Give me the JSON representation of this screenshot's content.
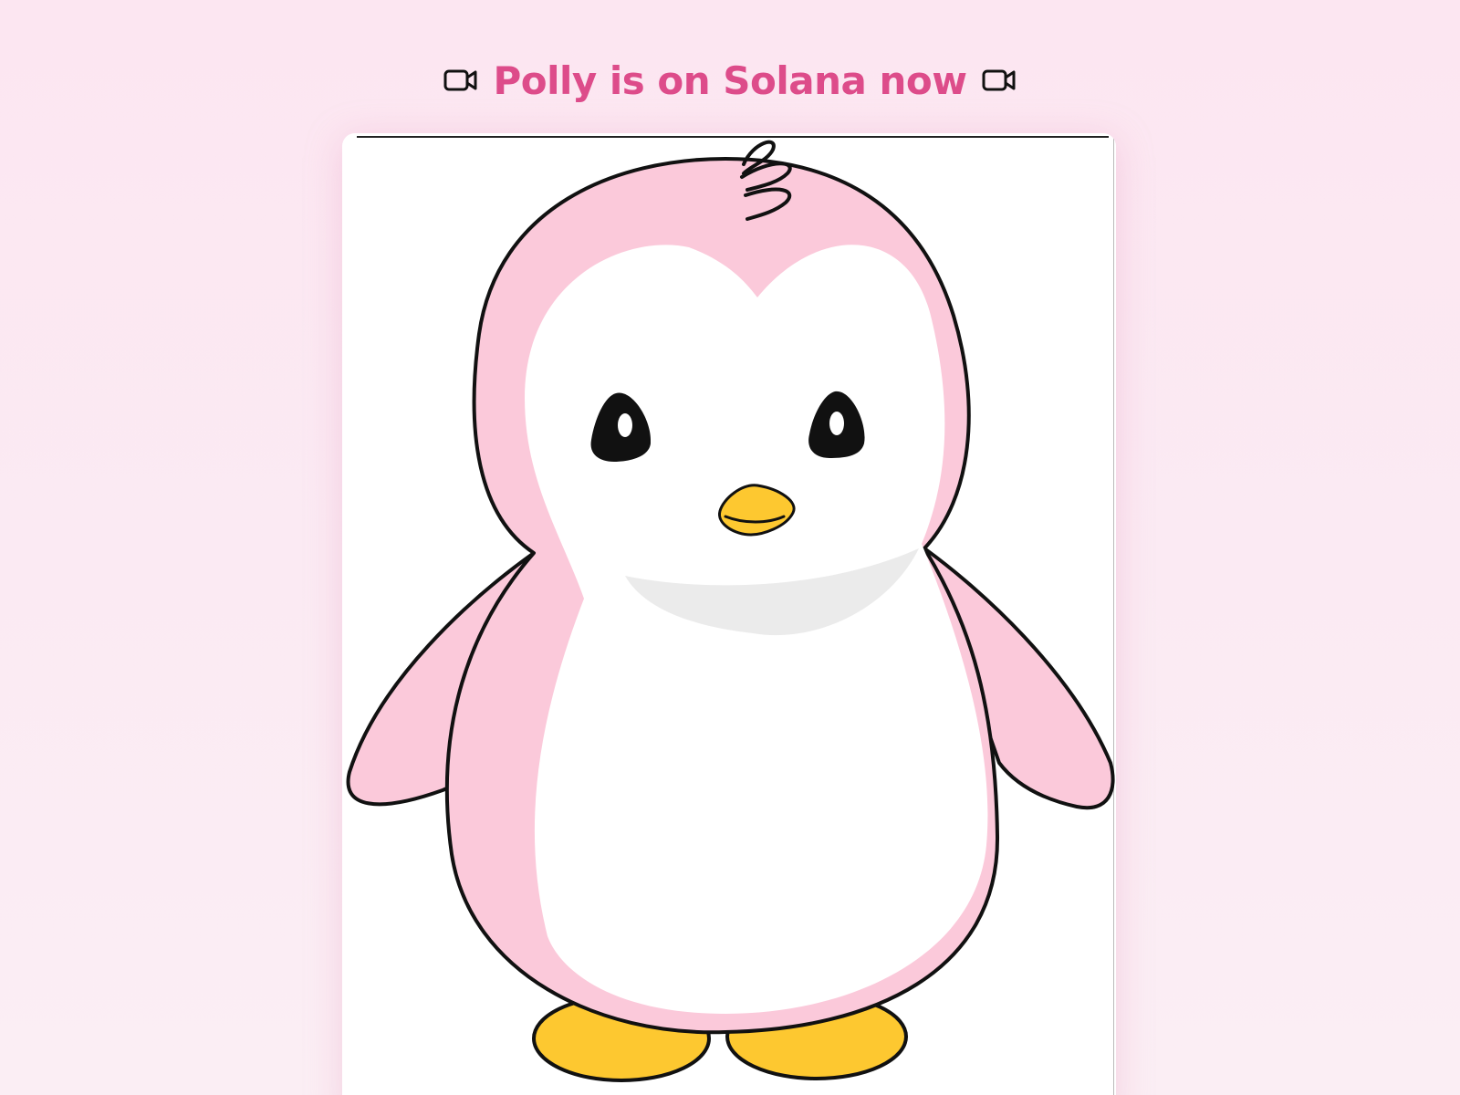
{
  "header": {
    "title": "Polly is on Solana now",
    "left_icon": "video-camera-icon",
    "right_icon": "video-camera-icon"
  },
  "card": {
    "image": "pink-penguin-illustration"
  },
  "colors": {
    "background": "#fce6f1",
    "title": "#dd4c8a",
    "penguin_body": "#fbc9da",
    "beak_feet": "#fdc830",
    "outline": "#111111"
  }
}
